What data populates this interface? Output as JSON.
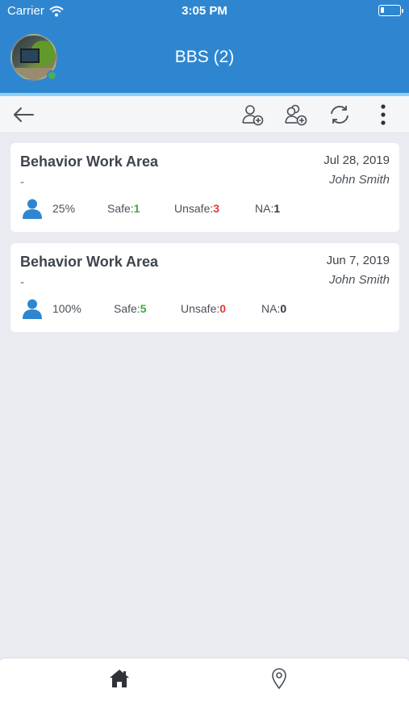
{
  "status_bar": {
    "carrier": "Carrier",
    "time": "3:05 PM"
  },
  "header": {
    "title": "BBS (2)"
  },
  "toolbar": {
    "icons": [
      "back-arrow-icon",
      "add-user-icon",
      "add-group-icon",
      "refresh-icon",
      "more-vertical-icon"
    ]
  },
  "records": [
    {
      "title": "Behavior Work Area",
      "date": "Jul 28, 2019",
      "subtitle": "-",
      "author": "John Smith",
      "percent": "25%",
      "safe_label": "Safe:",
      "safe": "1",
      "unsafe_label": "Unsafe:",
      "unsafe": "3",
      "na_label": "NA:",
      "na": "1"
    },
    {
      "title": "Behavior Work Area",
      "date": "Jun 7, 2019",
      "subtitle": "-",
      "author": "John Smith",
      "percent": "100%",
      "safe_label": "Safe:",
      "safe": "5",
      "unsafe_label": "Unsafe:",
      "unsafe": "0",
      "na_label": "NA:",
      "na": "0"
    }
  ],
  "tabbar": {
    "icons": [
      "home-icon",
      "location-pin-icon"
    ]
  },
  "colors": {
    "header_blue": "#2f86d0",
    "safe_green": "#3cab3c",
    "unsafe_red": "#e53935",
    "person_icon_blue": "#2f86d0"
  }
}
